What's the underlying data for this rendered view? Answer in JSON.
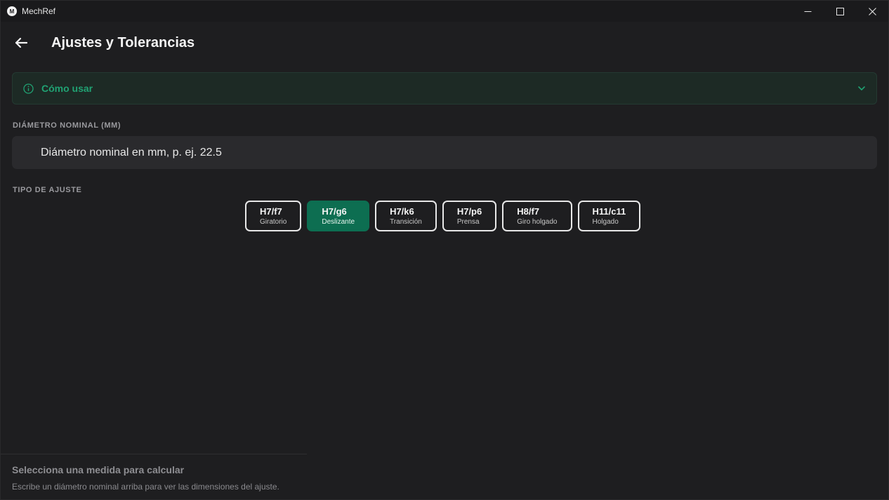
{
  "window": {
    "app_title": "MechRef",
    "logo_letter": "M"
  },
  "header": {
    "title": "Ajustes y Tolerancias"
  },
  "howto": {
    "label": "Cómo usar"
  },
  "diameter": {
    "section_label": "DIÁMETRO NOMINAL (MM)",
    "placeholder": "Diámetro nominal en mm, p. ej. 22.5",
    "value": ""
  },
  "fit_type": {
    "section_label": "TIPO DE AJUSTE",
    "selected": "H7/g6",
    "options": [
      {
        "code": "H7/f7",
        "desc": "Giratorio"
      },
      {
        "code": "H7/g6",
        "desc": "Deslizante"
      },
      {
        "code": "H7/k6",
        "desc": "Transición"
      },
      {
        "code": "H7/p6",
        "desc": "Prensa"
      },
      {
        "code": "H8/f7",
        "desc": "Giro holgado"
      },
      {
        "code": "H11/c11",
        "desc": "Holgado"
      }
    ]
  },
  "result_panel": {
    "title": "Selecciona una medida para calcular",
    "subtitle": "Escribe un diámetro nominal arriba para ver las dimensiones del ajuste."
  },
  "colors": {
    "accent": "#0d6e51",
    "howto_text": "#20a273",
    "background": "#1e1e20"
  }
}
